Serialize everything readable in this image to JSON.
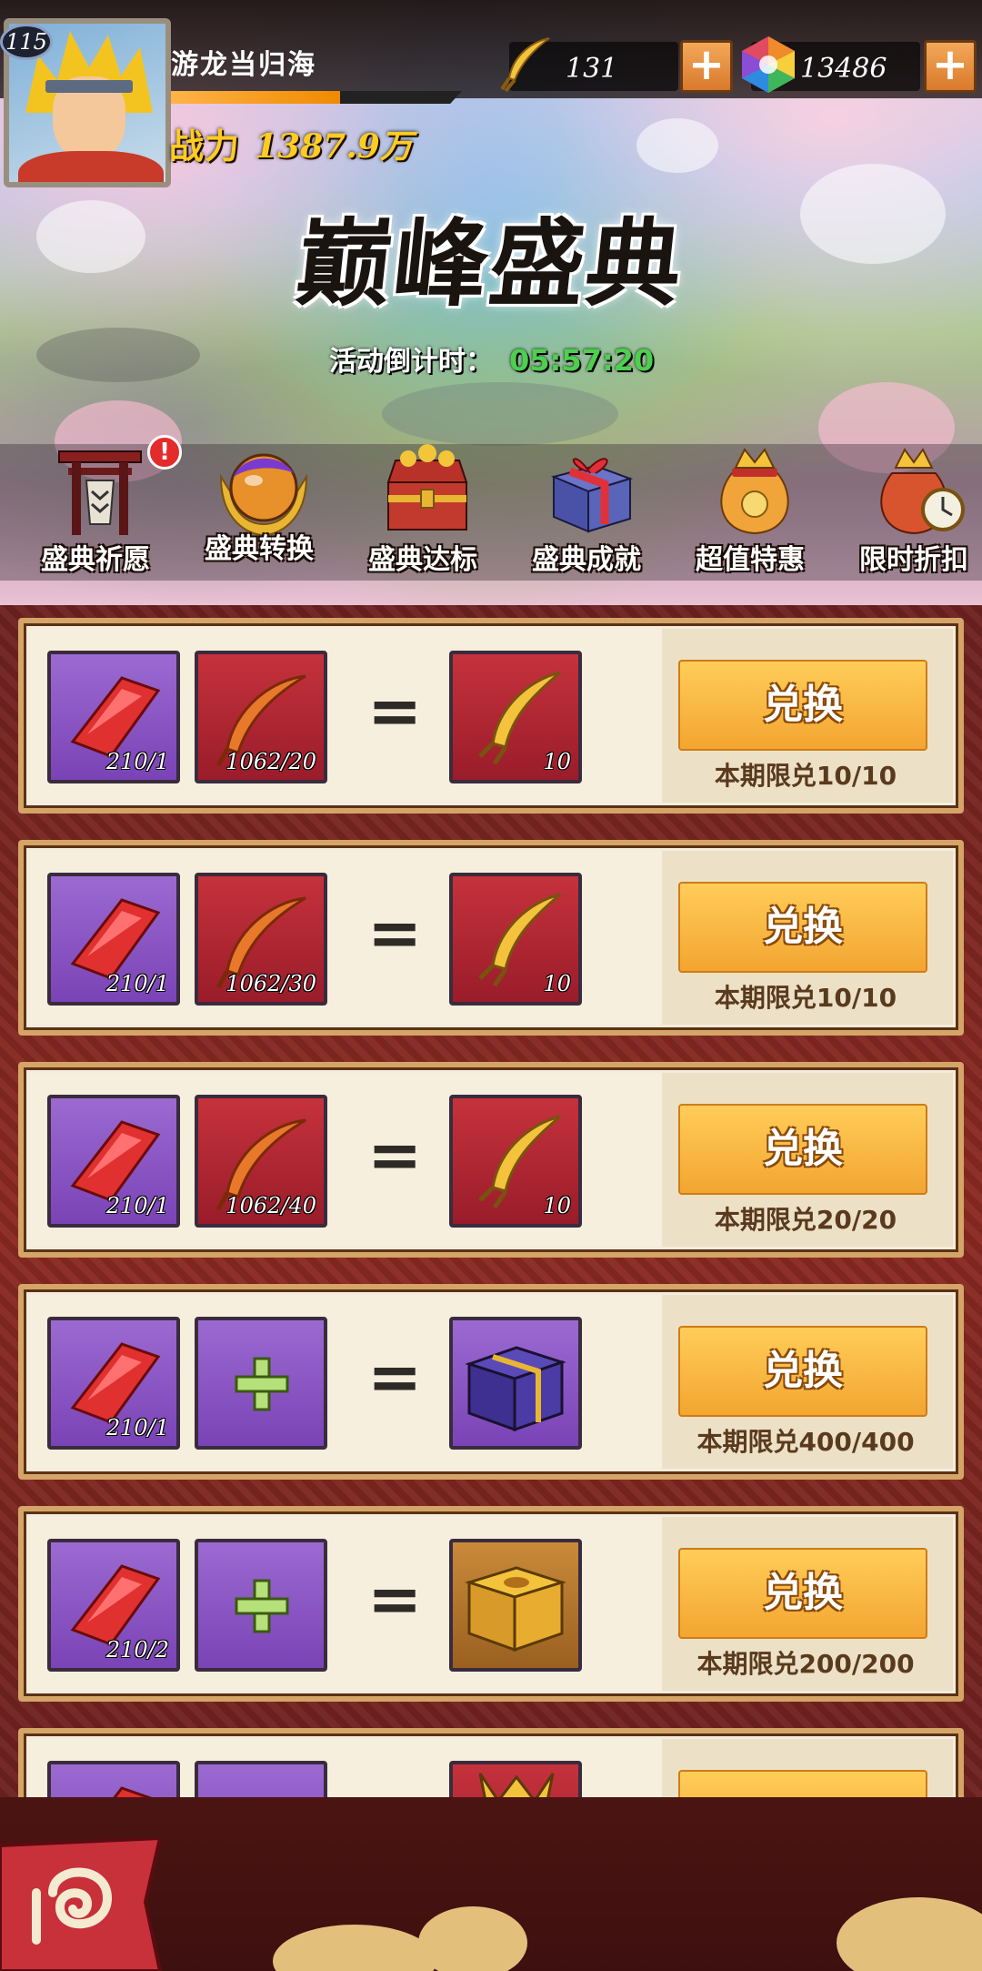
{
  "header": {
    "level": "115",
    "player_name": "游龙当归海",
    "exp_fraction": 0.58,
    "power_label": "战力",
    "power_value": "1387.9万",
    "resources": [
      {
        "icon": "feather-icon",
        "value": "131",
        "add_label": "+"
      },
      {
        "icon": "gem-icon",
        "value": "13486",
        "add_label": "+"
      }
    ]
  },
  "event": {
    "title": "巅峰盛典",
    "countdown_label": "活动倒计时：",
    "countdown_time": "05:57:20"
  },
  "tabs": [
    {
      "label": "盛典祈愿",
      "icon": "shrine-gate-icon",
      "badge": "!"
    },
    {
      "label": "盛典转换",
      "icon": "orb-emblem-icon",
      "selected": true
    },
    {
      "label": "盛典达标",
      "icon": "treasure-chest-icon"
    },
    {
      "label": "盛典成就",
      "icon": "gift-box-icon"
    },
    {
      "label": "超值特惠",
      "icon": "money-bag-icon"
    },
    {
      "label": "限时折扣",
      "icon": "clock-bag-icon"
    }
  ],
  "exchanges": [
    {
      "inputs": [
        {
          "item": "red-gem-icon",
          "frame": "purple",
          "count": "210/1"
        },
        {
          "item": "red-feather-icon",
          "frame": "red",
          "count": "1062/20"
        }
      ],
      "output": {
        "item": "gold-feather-icon",
        "frame": "red",
        "count": "10"
      },
      "button_label": "兑换",
      "limit": "本期限兑10/10"
    },
    {
      "inputs": [
        {
          "item": "red-gem-icon",
          "frame": "purple",
          "count": "210/1"
        },
        {
          "item": "red-feather-icon",
          "frame": "red",
          "count": "1062/30"
        }
      ],
      "output": {
        "item": "gold-feather-icon",
        "frame": "red",
        "count": "10"
      },
      "button_label": "兑换",
      "limit": "本期限兑10/10"
    },
    {
      "inputs": [
        {
          "item": "red-gem-icon",
          "frame": "purple",
          "count": "210/1"
        },
        {
          "item": "red-feather-icon",
          "frame": "red",
          "count": "1062/40"
        }
      ],
      "output": {
        "item": "gold-feather-icon",
        "frame": "red",
        "count": "10"
      },
      "button_label": "兑换",
      "limit": "本期限兑20/20"
    },
    {
      "inputs": [
        {
          "item": "red-gem-icon",
          "frame": "purple",
          "count": "210/1"
        },
        {
          "item": "plus-slot-icon",
          "frame": "purple",
          "count": ""
        }
      ],
      "output": {
        "item": "purple-box-icon",
        "frame": "purple",
        "count": ""
      },
      "button_label": "兑换",
      "limit": "本期限兑400/400"
    },
    {
      "inputs": [
        {
          "item": "red-gem-icon",
          "frame": "purple",
          "count": "210/2"
        },
        {
          "item": "plus-slot-icon",
          "frame": "purple",
          "count": ""
        }
      ],
      "output": {
        "item": "gold-box-icon",
        "frame": "gold",
        "count": ""
      },
      "button_label": "兑换",
      "limit": "本期限兑200/200"
    },
    {
      "inputs": [
        {
          "item": "red-gem-icon",
          "frame": "purple",
          "count": ""
        },
        {
          "item": "plus-slot-icon",
          "frame": "purple",
          "count": ""
        }
      ],
      "output": {
        "item": "gold-item-icon",
        "frame": "red",
        "count": ""
      },
      "button_label": "",
      "limit": ""
    }
  ],
  "colors": {
    "accent_gold": "#f3a531",
    "frame_purple": "#7a43b6",
    "frame_red": "#9a1c2a",
    "countdown_green": "#4dd04d",
    "power_yellow": "#ffcc22"
  },
  "footer": {
    "back_icon": "swirl-back-icon"
  }
}
